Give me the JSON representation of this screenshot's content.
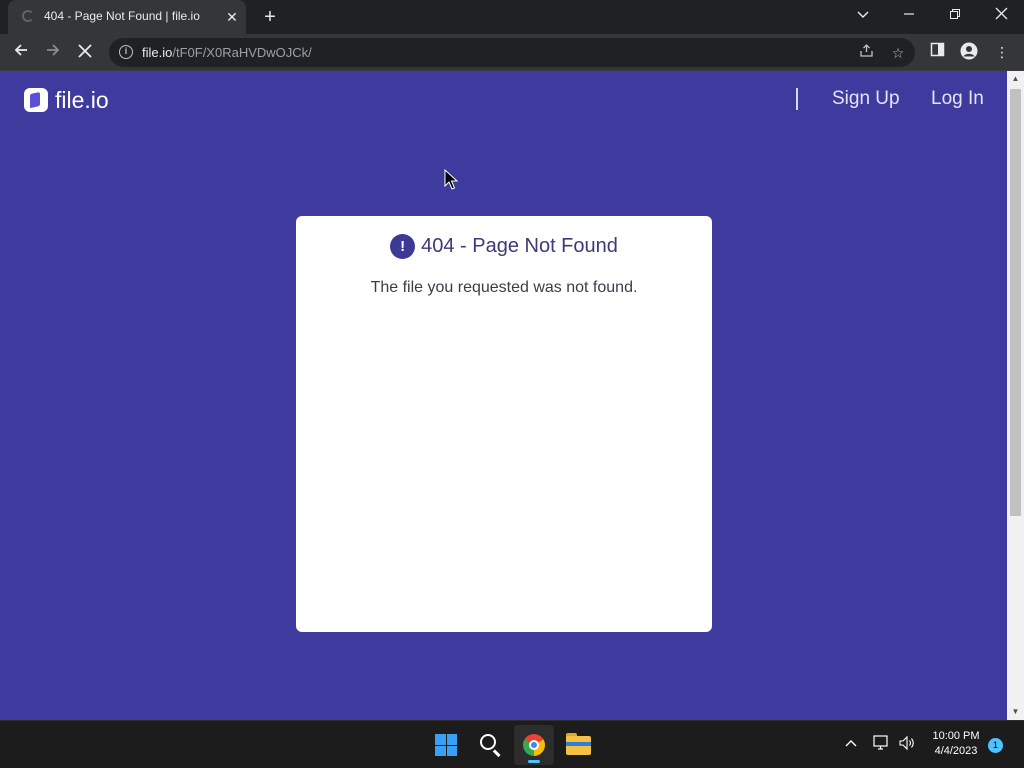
{
  "browser": {
    "tab": {
      "title": "404 - Page Not Found | file.io",
      "close_icon": "close-icon"
    },
    "new_tab_icon": "plus-icon",
    "window_controls": [
      "chevron-down-icon",
      "minimize-icon",
      "restore-icon",
      "close-icon"
    ],
    "address": {
      "host": "file.io",
      "path": "/tF0F/X0RaHVDwOJCk/"
    },
    "toolbar_icons": [
      "back-icon",
      "forward-icon",
      "stop-loading-icon",
      "info-icon",
      "share-icon",
      "star-icon",
      "side-panel-icon",
      "profile-icon",
      "menu-icon"
    ]
  },
  "site": {
    "logo_text": "file.io",
    "nav": {
      "signup": "Sign Up",
      "login": "Log In"
    },
    "colors": {
      "background": "#3f3a9e",
      "card": "#ffffff",
      "accent": "#3c3a96"
    }
  },
  "error_card": {
    "title": "404 - Page Not Found",
    "message": "The file you requested was not found.",
    "icon": "exclamation-icon"
  },
  "taskbar": {
    "apps": [
      "windows-start-icon",
      "search-icon",
      "chrome-icon",
      "file-explorer-icon"
    ],
    "time": "10:00 PM",
    "date": "4/4/2023",
    "notification_count": "1"
  }
}
